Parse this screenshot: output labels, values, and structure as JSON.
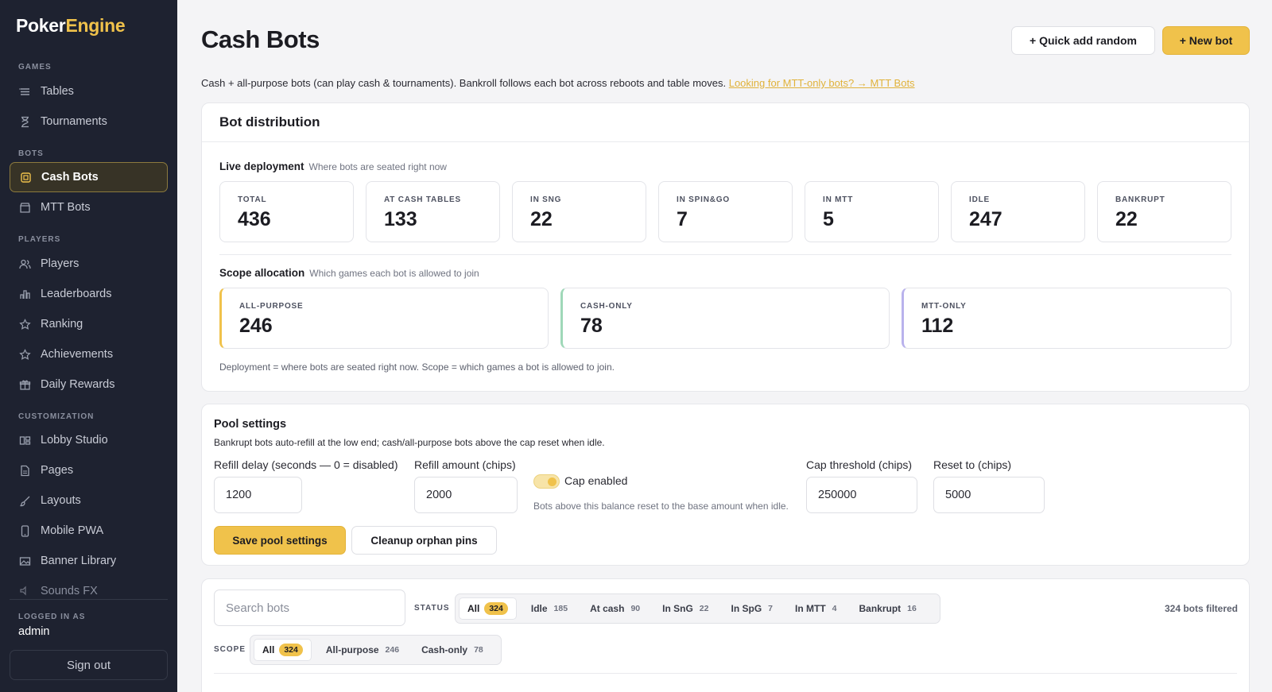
{
  "brand": {
    "part1": "Poker",
    "part2": "Engine"
  },
  "sidebar": {
    "sections": {
      "games": "GAMES",
      "bots": "BOTS",
      "players": "PLAYERS",
      "customization": "CUSTOMIZATION"
    },
    "items": [
      {
        "label": "Tables",
        "icon": "list-icon"
      },
      {
        "label": "Tournaments",
        "icon": "hourglass-icon"
      },
      {
        "label": "Cash Bots",
        "icon": "chip-icon",
        "active": true
      },
      {
        "label": "MTT Bots",
        "icon": "box-icon"
      },
      {
        "label": "Players",
        "icon": "users-icon"
      },
      {
        "label": "Leaderboards",
        "icon": "bar-chart-icon"
      },
      {
        "label": "Ranking",
        "icon": "star-icon"
      },
      {
        "label": "Achievements",
        "icon": "star-outline-icon"
      },
      {
        "label": "Daily Rewards",
        "icon": "gift-icon"
      },
      {
        "label": "Lobby Studio",
        "icon": "layout-icon"
      },
      {
        "label": "Pages",
        "icon": "document-icon"
      },
      {
        "label": "Layouts",
        "icon": "brush-icon"
      },
      {
        "label": "Mobile PWA",
        "icon": "phone-icon"
      },
      {
        "label": "Banner Library",
        "icon": "image-icon"
      },
      {
        "label": "Sounds FX",
        "icon": "sound-icon"
      }
    ],
    "logged_in_label": "LOGGED IN AS",
    "logged_in_user": "admin",
    "sign_out": "Sign out"
  },
  "header": {
    "title": "Cash Bots",
    "quick_add": "+ Quick add random",
    "new_bot": "+ New bot",
    "intro": "Cash + all-purpose bots (can play cash & tournaments). Bankroll follows each bot across reboots and table moves.",
    "intro_link": "Looking for MTT-only bots? → MTT Bots"
  },
  "distribution": {
    "title": "Bot distribution",
    "live_title": "Live deployment",
    "live_subtitle": "Where bots are seated right now",
    "stats": [
      {
        "label": "TOTAL",
        "value": "436"
      },
      {
        "label": "AT CASH TABLES",
        "value": "133"
      },
      {
        "label": "IN SNG",
        "value": "22"
      },
      {
        "label": "IN SPIN&GO",
        "value": "7"
      },
      {
        "label": "IN MTT",
        "value": "5"
      },
      {
        "label": "IDLE",
        "value": "247"
      },
      {
        "label": "BANKRUPT",
        "value": "22"
      }
    ],
    "scope_title": "Scope allocation",
    "scope_subtitle": "Which games each bot is allowed to join",
    "scopes": [
      {
        "label": "ALL-PURPOSE",
        "value": "246",
        "color": "#f0c24b"
      },
      {
        "label": "CASH-ONLY",
        "value": "78",
        "color": "#9fd8b8"
      },
      {
        "label": "MTT-ONLY",
        "value": "112",
        "color": "#b9b2ec"
      }
    ],
    "footnote": "Deployment = where bots are seated right now. Scope = which games a bot is allowed to join."
  },
  "pool": {
    "title": "Pool settings",
    "description": "Bankrupt bots auto-refill at the low end; cash/all-purpose bots above the cap reset when idle.",
    "refill_delay_label": "Refill delay (seconds — 0 = disabled)",
    "refill_delay_value": "1200",
    "refill_amount_label": "Refill amount (chips)",
    "refill_amount_value": "2000",
    "cap_label": "Cap enabled",
    "cap_hint": "Bots above this balance reset to the base amount when idle.",
    "cap_threshold_label": "Cap threshold (chips)",
    "cap_threshold_value": "250000",
    "reset_label": "Reset to (chips)",
    "reset_value": "5000",
    "save": "Save pool settings",
    "cleanup": "Cleanup orphan pins"
  },
  "filters": {
    "search_placeholder": "Search bots",
    "status_label": "STATUS",
    "status": [
      {
        "label": "All",
        "count": "324",
        "active": true
      },
      {
        "label": "Idle",
        "count": "185"
      },
      {
        "label": "At cash",
        "count": "90"
      },
      {
        "label": "In SnG",
        "count": "22"
      },
      {
        "label": "In SpG",
        "count": "7"
      },
      {
        "label": "In MTT",
        "count": "4"
      },
      {
        "label": "Bankrupt",
        "count": "16"
      }
    ],
    "filtered_text": "324 bots filtered",
    "scope_label": "SCOPE",
    "scope": [
      {
        "label": "All",
        "count": "324",
        "active": true
      },
      {
        "label": "All-purpose",
        "count": "246"
      },
      {
        "label": "Cash-only",
        "count": "78"
      }
    ]
  },
  "colors": {
    "accent": "#f0c24b",
    "sidebar_bg": "#1e2230",
    "page_bg": "#f4f4f6"
  }
}
